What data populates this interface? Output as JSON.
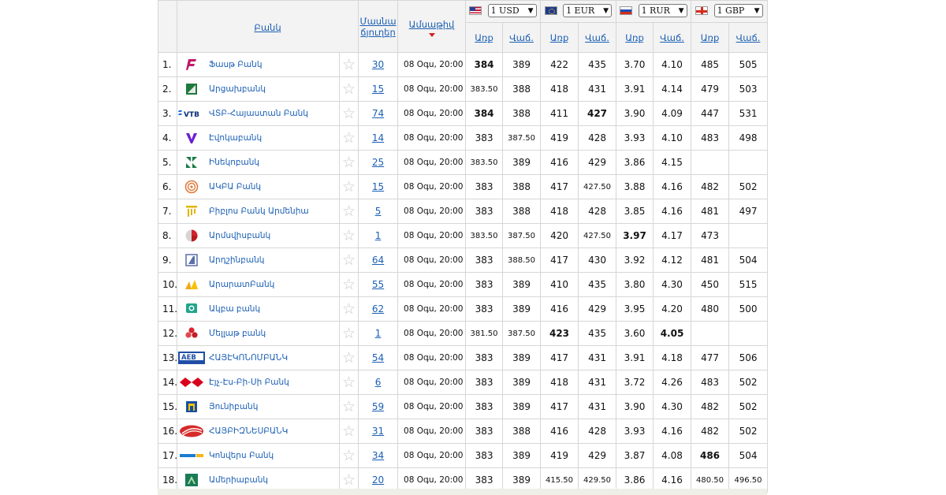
{
  "header": {
    "bank_col": "Բանկ",
    "branches_col_l1": "Մասնա",
    "branches_col_l2": "ճյուղեր",
    "date_col": "Ամսաթիվ",
    "buy_label": "Առք",
    "sell_label": "Վաճ."
  },
  "currencies": [
    {
      "flag": "us-flag-icon",
      "selected": "1 USD"
    },
    {
      "flag": "eu-flag-icon",
      "selected": "1 EUR"
    },
    {
      "flag": "ru-flag-icon",
      "selected": "1 RUR"
    },
    {
      "flag": "gb-flag-icon",
      "selected": "1 GBP"
    }
  ],
  "colors": {
    "link": "#1a5fb4",
    "sort_arrow": "#d42020",
    "header_bg": "#f3f3f3"
  },
  "rows": [
    {
      "n": "1.",
      "name": "Ֆասթ Բանկ",
      "logo": "fast-bank-logo-icon",
      "branches": "30",
      "date": "08 Օգս, 20:00",
      "rates": [
        "384",
        "389",
        "422",
        "435",
        "3.70",
        "4.10",
        "485",
        "505"
      ],
      "bold": [
        0
      ]
    },
    {
      "n": "2.",
      "name": "Արցախբանկ",
      "logo": "artsakhbank-logo-icon",
      "branches": "15",
      "date": "08 Օգս, 20:00",
      "rates": [
        "383.50",
        "388",
        "418",
        "431",
        "3.91",
        "4.14",
        "479",
        "503"
      ],
      "bold": []
    },
    {
      "n": "3.",
      "name": "ՎՏԲ-Հայաստան Բանկ",
      "logo": "vtb-logo-icon",
      "branches": "74",
      "date": "08 Օգս, 20:00",
      "rates": [
        "384",
        "388",
        "411",
        "427",
        "3.90",
        "4.09",
        "447",
        "531"
      ],
      "bold": [
        0,
        3
      ]
    },
    {
      "n": "4.",
      "name": "Էվոկաբանկ",
      "logo": "evocabank-logo-icon",
      "branches": "14",
      "date": "08 Օգս, 20:00",
      "rates": [
        "383",
        "387.50",
        "419",
        "428",
        "3.93",
        "4.10",
        "483",
        "498"
      ],
      "bold": []
    },
    {
      "n": "5.",
      "name": "Ինեկոբանկ",
      "logo": "inecobank-logo-icon",
      "branches": "25",
      "date": "08 Օգս, 20:00",
      "rates": [
        "383.50",
        "389",
        "416",
        "429",
        "3.86",
        "4.15",
        "",
        ""
      ],
      "bold": []
    },
    {
      "n": "6.",
      "name": "ԱԿԲԱ Բանկ",
      "logo": "acba-logo-icon",
      "branches": "15",
      "date": "08 Օգս, 20:00",
      "rates": [
        "383",
        "388",
        "417",
        "427.50",
        "3.88",
        "4.16",
        "482",
        "502"
      ],
      "bold": []
    },
    {
      "n": "7.",
      "name": "Բիբլոս Բանկ Արմենիա",
      "logo": "byblos-logo-icon",
      "branches": "5",
      "date": "08 Օգս, 20:00",
      "rates": [
        "383",
        "388",
        "418",
        "428",
        "3.85",
        "4.16",
        "481",
        "497"
      ],
      "bold": []
    },
    {
      "n": "8.",
      "name": "Արմսվիսբանկ",
      "logo": "armswissbank-logo-icon",
      "branches": "1",
      "date": "08 Օգս, 20:00",
      "rates": [
        "383.50",
        "387.50",
        "420",
        "427.50",
        "3.97",
        "4.17",
        "473",
        ""
      ],
      "bold": [
        4
      ]
    },
    {
      "n": "9.",
      "name": "Արդշինբանկ",
      "logo": "ardshinbank-logo-icon",
      "branches": "64",
      "date": "08 Օգս, 20:00",
      "rates": [
        "383",
        "388.50",
        "417",
        "430",
        "3.92",
        "4.12",
        "481",
        "504"
      ],
      "bold": []
    },
    {
      "n": "10.",
      "name": "ԱրարատԲանկ",
      "logo": "araratbank-logo-icon",
      "branches": "55",
      "date": "08 Օգս, 20:00",
      "rates": [
        "383",
        "389",
        "410",
        "435",
        "3.80",
        "4.30",
        "450",
        "515"
      ],
      "bold": []
    },
    {
      "n": "11.",
      "name": "Ակբա բանկ",
      "logo": "bank-11-logo-icon",
      "branches": "62",
      "date": "08 Օգս, 20:00",
      "rates": [
        "383",
        "389",
        "416",
        "429",
        "3.95",
        "4.20",
        "480",
        "500"
      ],
      "bold": []
    },
    {
      "n": "12.",
      "name": "Մելլաթ բանկ",
      "logo": "mellat-logo-icon",
      "branches": "1",
      "date": "08 Օգս, 20:00",
      "rates": [
        "381.50",
        "387.50",
        "423",
        "435",
        "3.60",
        "4.05",
        "",
        ""
      ],
      "bold": [
        2,
        5
      ]
    },
    {
      "n": "13.",
      "name": "ՀԱՅԷԿՈՆՈՄԲԱՆԿ",
      "logo": "aeb-logo-icon",
      "branches": "54",
      "date": "08 Օգս, 20:00",
      "rates": [
        "383",
        "389",
        "417",
        "431",
        "3.91",
        "4.18",
        "477",
        "506"
      ],
      "bold": []
    },
    {
      "n": "14.",
      "name": "Էյչ-Էս-Բի-Սի Բանկ",
      "logo": "hsbc-logo-icon",
      "branches": "6",
      "date": "08 Օգս, 20:00",
      "rates": [
        "383",
        "389",
        "418",
        "431",
        "3.72",
        "4.26",
        "483",
        "502"
      ],
      "bold": []
    },
    {
      "n": "15.",
      "name": "Յունիբանկ",
      "logo": "unibank-logo-icon",
      "branches": "59",
      "date": "08 Օգս, 20:00",
      "rates": [
        "383",
        "389",
        "417",
        "431",
        "3.90",
        "4.30",
        "482",
        "502"
      ],
      "bold": []
    },
    {
      "n": "16.",
      "name": "ՀԱՅԲԻԶՆԵՍԲԱՆԿ",
      "logo": "armbusinessbank-logo-icon",
      "branches": "31",
      "date": "08 Օգս, 20:00",
      "rates": [
        "383",
        "388",
        "416",
        "428",
        "3.93",
        "4.16",
        "482",
        "502"
      ],
      "bold": []
    },
    {
      "n": "17.",
      "name": "Կոնվերս Բանկ",
      "logo": "converse-logo-icon",
      "branches": "34",
      "date": "08 Օգս, 20:00",
      "rates": [
        "383",
        "389",
        "419",
        "429",
        "3.87",
        "4.08",
        "486",
        "504"
      ],
      "bold": [
        6
      ]
    },
    {
      "n": "18.",
      "name": "Ամերիաբանկ",
      "logo": "ameriabank-logo-icon",
      "branches": "20",
      "date": "08 Օգս, 20:00",
      "rates": [
        "383",
        "389",
        "415.50",
        "429.50",
        "3.86",
        "4.16",
        "480.50",
        "496.50"
      ],
      "bold": []
    }
  ]
}
